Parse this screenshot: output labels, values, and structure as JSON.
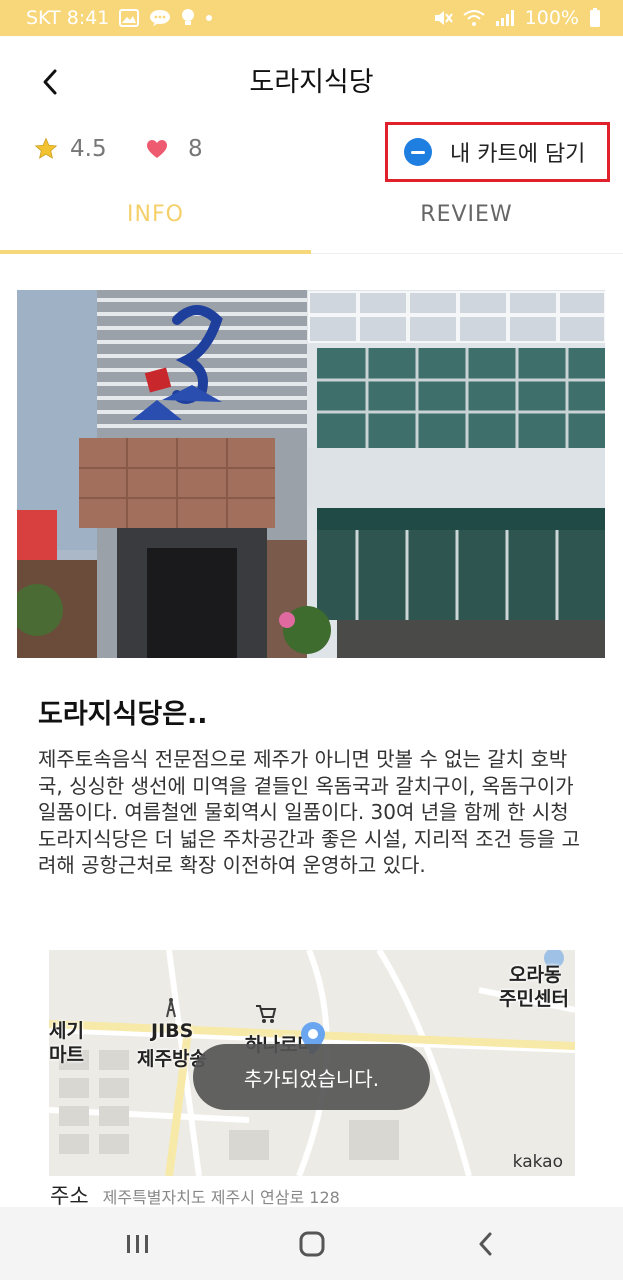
{
  "status_bar": {
    "carrier_time": "SKT 8:41",
    "battery": "100%",
    "icons": [
      "image-icon",
      "chat-icon",
      "bulb-icon",
      "dot-icon",
      "mute-icon",
      "wifi-icon",
      "signal-icon",
      "battery-icon"
    ]
  },
  "header": {
    "title": "도라지식당",
    "back_icon": "back-arrow-icon"
  },
  "stats": {
    "rating": "4.5",
    "likes": "8",
    "cart_button_label": "내 카트에 담기"
  },
  "tabs": [
    {
      "label": "INFO",
      "active": true
    },
    {
      "label": "REVIEW",
      "active": false
    }
  ],
  "intro": {
    "title": "도라지식당은..",
    "description": "제주토속음식 전문점으로 제주가 아니면 맛볼 수 없는 갈치 호박국, 싱싱한 생선에 미역을 곁들인 옥돔국과 갈치구이, 옥돔구이가 일품이다. 여름철엔 물회역시 일품이다. 30여 년을 함께 한 시청 도라지식당은 더 넓은 주차공간과 좋은 시설, 지리적 조건 등을 고려해 공항근처로 확장 이전하여 운영하고 있다."
  },
  "map": {
    "labels": [
      "오라동",
      "주민센터",
      "세기",
      "마트",
      "JIBS",
      "제주방송",
      "하나로마"
    ],
    "brand": "kakao"
  },
  "address": {
    "label": "주소",
    "value": "제주특별자치도 제주시 연삼로 128"
  },
  "toast": {
    "message": "추가되었습니다."
  },
  "colors": {
    "status_bar": "#f8d77a",
    "accent_tab": "#f4cf6a",
    "highlight_border": "#e0202a",
    "cart_icon": "#1e7fe0"
  }
}
